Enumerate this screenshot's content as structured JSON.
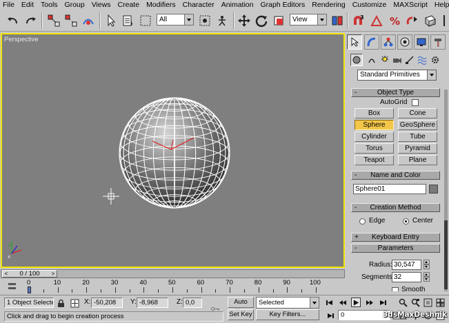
{
  "menubar": {
    "items": [
      "File",
      "Edit",
      "Tools",
      "Group",
      "Views",
      "Create",
      "Modifiers",
      "Character",
      "Animation",
      "Graph Editors",
      "Rendering",
      "Customize",
      "MAXScript",
      "Help"
    ]
  },
  "toolbar": {
    "selection_filter": "All",
    "reference_coord": "View"
  },
  "viewport": {
    "label": "Perspective",
    "border_color": "#f2e400"
  },
  "command_panel": {
    "category_dropdown": "Standard Primitives",
    "object_type": {
      "header": "Object Type",
      "autogrid_label": "AutoGrid",
      "buttons": [
        {
          "label": "Box",
          "active": false
        },
        {
          "label": "Cone",
          "active": false
        },
        {
          "label": "Sphere",
          "active": true
        },
        {
          "label": "GeoSphere",
          "active": false
        },
        {
          "label": "Cylinder",
          "active": false
        },
        {
          "label": "Tube",
          "active": false
        },
        {
          "label": "Torus",
          "active": false
        },
        {
          "label": "Pyramid",
          "active": false
        },
        {
          "label": "Teapot",
          "active": false
        },
        {
          "label": "Plane",
          "active": false
        }
      ],
      "header_sign": "-"
    },
    "name_and_color": {
      "header": "Name and Color",
      "header_sign": "-",
      "name_value": "Sphere01"
    },
    "creation_method": {
      "header": "Creation Method",
      "header_sign": "-",
      "edge_label": "Edge",
      "center_label": "Center",
      "selected": "Center"
    },
    "keyboard_entry": {
      "header": "Keyboard Entry",
      "header_sign": "+"
    },
    "parameters": {
      "header": "Parameters",
      "header_sign": "-",
      "radius_label": "Radius:",
      "radius_value": "30,547",
      "segments_label": "Segments:",
      "segments_value": "32",
      "smooth_label": "Smooth"
    }
  },
  "timeslider": {
    "position_label": "0 / 100",
    "prev_arrow": "<",
    "next_arrow": ">"
  },
  "trackbar": {
    "ticks": [
      "0",
      "10",
      "20",
      "30",
      "40",
      "50",
      "60",
      "70",
      "80",
      "90",
      "100"
    ]
  },
  "statusbar": {
    "selection_count": "1 Object Selecte",
    "x_label": "X:",
    "x_value": "-50,208",
    "y_label": "Y:",
    "y_value": "-8,968",
    "z_label": "Z:",
    "z_value": "0,0",
    "auto_key_label": "Auto Key",
    "set_key_label": "Set Key",
    "key_mode": "Selected",
    "key_filters_label": "Key Filters...",
    "frame_value": "0",
    "prompt": "Click and drag to begin creation process"
  },
  "watermark": "3dsMaxDeshnik"
}
